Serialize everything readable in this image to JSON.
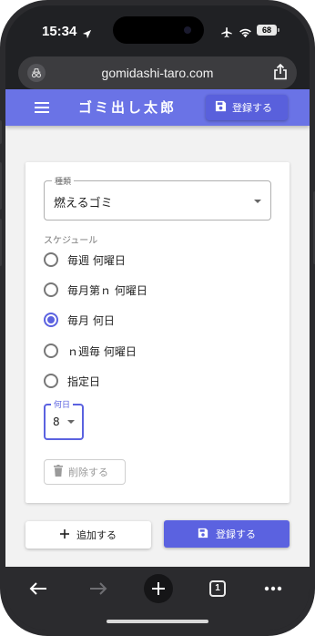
{
  "status_bar": {
    "time": "15:34",
    "battery": "68"
  },
  "browser": {
    "url": "gomidashi-taro.com",
    "tab_count": "1"
  },
  "app": {
    "title": "ゴミ出し太郎",
    "header_save_label": "登録する"
  },
  "form": {
    "type_field": {
      "label": "種類",
      "value": "燃えるゴミ"
    },
    "schedule_label": "スケジュール",
    "schedule_options": [
      {
        "label": "毎週 何曜日",
        "selected": false
      },
      {
        "label": "毎月第ｎ 何曜日",
        "selected": false
      },
      {
        "label": "毎月 何日",
        "selected": true
      },
      {
        "label": "ｎ週毎 何曜日",
        "selected": false
      },
      {
        "label": "指定日",
        "selected": false
      }
    ],
    "day_field": {
      "label": "何日",
      "value": "8"
    },
    "delete_label": "削除する"
  },
  "actions": {
    "add_label": "追加する",
    "save_label": "登録する"
  },
  "colors": {
    "primary": "#6a73e6",
    "primary_dark": "#5b62e0",
    "background": "#f2f2f2"
  },
  "icons": [
    "location-arrow-icon",
    "airplane-icon",
    "wifi-icon",
    "site-settings-icon",
    "share-icon",
    "menu-icon",
    "save-icon",
    "trash-icon",
    "plus-icon",
    "back-arrow-icon",
    "forward-arrow-icon",
    "new-tab-icon",
    "tabs-icon",
    "more-icon"
  ]
}
